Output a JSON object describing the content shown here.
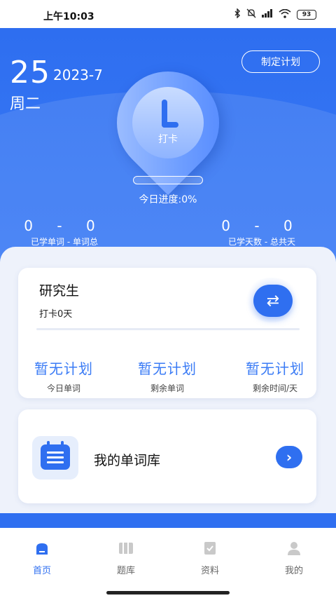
{
  "status_bar": {
    "time": "上午10:03",
    "battery": "93",
    "icons": [
      "bluetooth-icon",
      "mute-icon",
      "signal-icon",
      "wifi-icon",
      "battery-icon"
    ]
  },
  "header": {
    "day": "25",
    "year_month": "2023-7",
    "weekday": "周二",
    "plan_button": "制定计划",
    "checkin_label": "打卡",
    "progress_fraction": 0,
    "progress_text": "今日进度:0%",
    "stats": [
      {
        "value": "0 - 0",
        "label": "已学单词 - 单词总"
      },
      {
        "value": "0 - 0",
        "label": "已学天数 - 总共天"
      }
    ]
  },
  "plan_card": {
    "title": "研究生",
    "subtitle": "打卡0天",
    "metrics": [
      {
        "value": "暂无计划",
        "label": "今日单词"
      },
      {
        "value": "暂无计划",
        "label": "剩余单词"
      },
      {
        "value": "暂无计划",
        "label": "剩余时间/天"
      }
    ]
  },
  "library_card": {
    "title": "我的单词库"
  },
  "tabbar": {
    "tabs": [
      {
        "label": "首页",
        "icon": "home-icon",
        "active": true
      },
      {
        "label": "题库",
        "icon": "book-icon",
        "active": false
      },
      {
        "label": "资料",
        "icon": "document-icon",
        "active": false
      },
      {
        "label": "我的",
        "icon": "user-icon",
        "active": false
      }
    ]
  },
  "colors": {
    "accent": "#2f6ff0",
    "metric_text": "#3a7bf5"
  }
}
